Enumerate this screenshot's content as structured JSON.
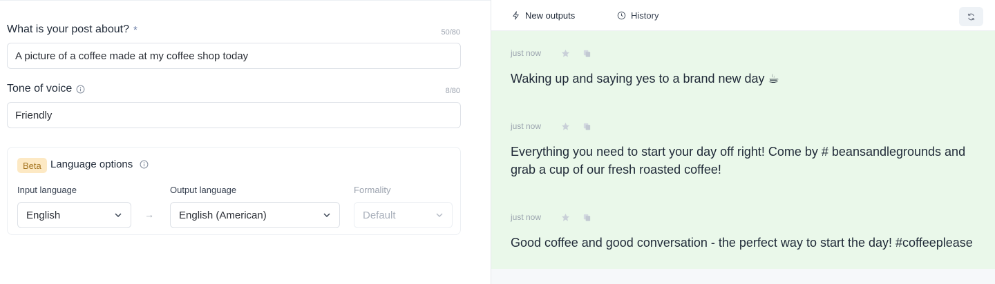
{
  "form": {
    "post_about": {
      "label": "What is your post about?",
      "required_mark": "*",
      "counter": "50/80",
      "value": "A picture of a coffee made at my coffee shop today"
    },
    "tone": {
      "label": "Tone of voice",
      "counter": "8/80",
      "value": "Friendly"
    },
    "language": {
      "badge": "Beta",
      "title": "Language options",
      "input_label": "Input language",
      "input_value": "English",
      "arrow": "→",
      "output_label": "Output language",
      "output_value": "English (American)",
      "formality_label": "Formality",
      "formality_value": "Default"
    }
  },
  "panel": {
    "tabs": [
      {
        "label": "New outputs",
        "icon": "lightning-icon",
        "active": true
      },
      {
        "label": "History",
        "icon": "clock-icon",
        "active": false
      }
    ],
    "refresh_icon": "refresh-icon",
    "background": "#eaf8ea",
    "outputs": [
      {
        "time": "just now",
        "text": "Waking up and saying yes to a brand new day ☕"
      },
      {
        "time": "just now",
        "text": "Everything you need to start your day off right! Come by # beansandlegrounds and grab a cup of our fresh roasted coffee!"
      },
      {
        "time": "just now",
        "text": "Good coffee and good conversation - the perfect way to start the day! #coffeeplease"
      }
    ]
  }
}
